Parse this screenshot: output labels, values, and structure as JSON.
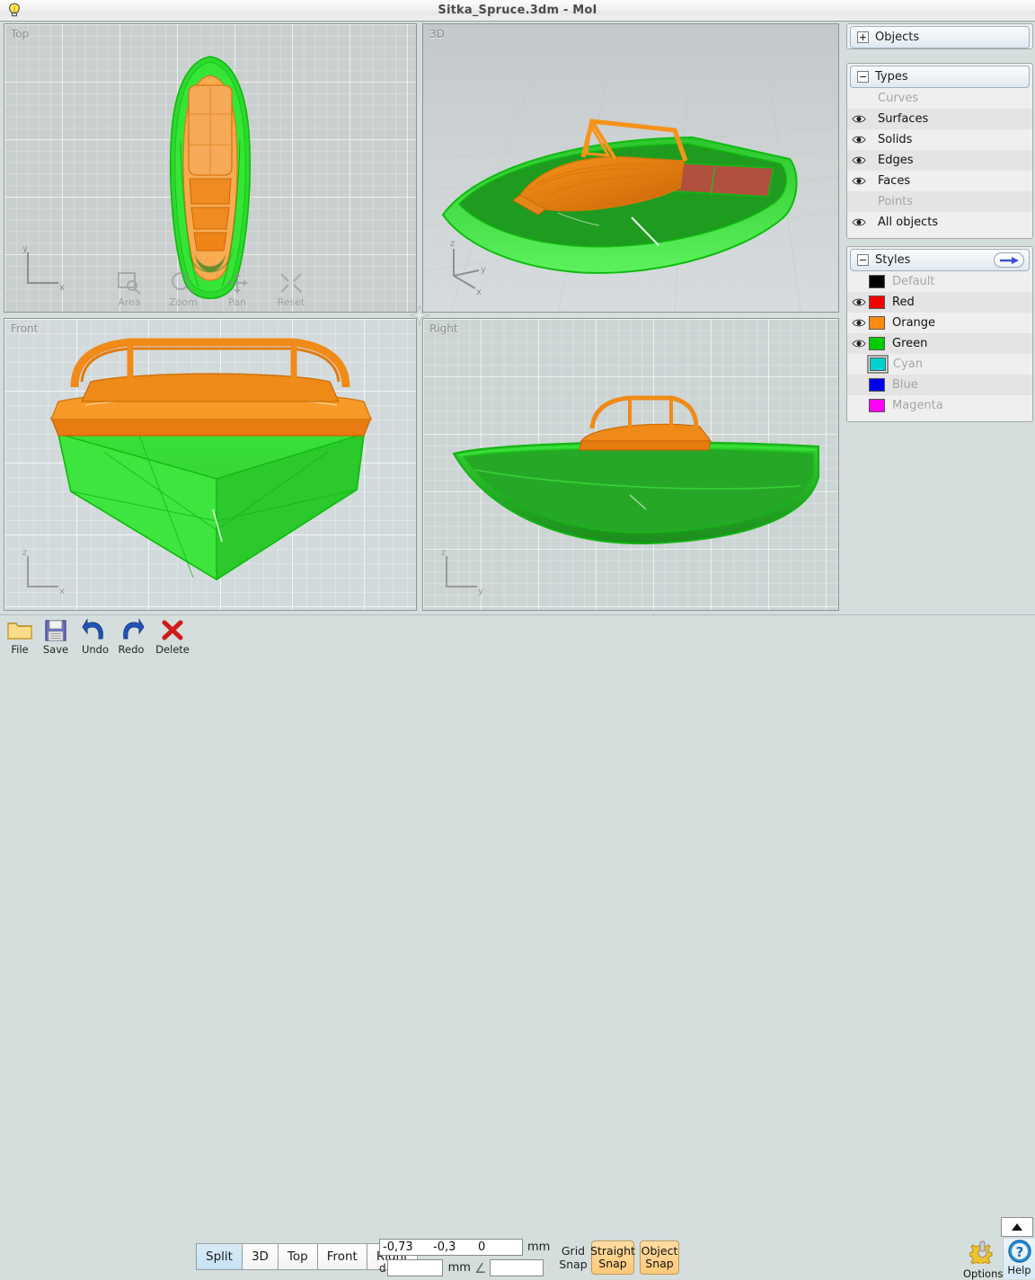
{
  "window": {
    "title": "Sitka_Spruce.3dm - MoI",
    "icon": "lightbulb-icon"
  },
  "viewports": [
    {
      "id": "top",
      "label": "Top",
      "axes": [
        "y",
        "x"
      ]
    },
    {
      "id": "3d",
      "label": "3D",
      "axes": [
        "z",
        "y",
        "x"
      ]
    },
    {
      "id": "front",
      "label": "Front",
      "axes": [
        "z",
        "x"
      ]
    },
    {
      "id": "right",
      "label": "Right",
      "axes": [
        "z",
        "y"
      ]
    }
  ],
  "nav_widgets": [
    {
      "name": "area",
      "label": "Area"
    },
    {
      "name": "zoom",
      "label": "Zoom"
    },
    {
      "name": "pan",
      "label": "Pan"
    },
    {
      "name": "reset",
      "label": "Reset"
    }
  ],
  "sidepanel": {
    "objects": {
      "label": "Objects",
      "expanded": false,
      "expander": "plus"
    },
    "types": {
      "label": "Types",
      "expanded": true,
      "expander": "minus",
      "items": [
        {
          "label": "Curves",
          "visible": false,
          "dim": true
        },
        {
          "label": "Surfaces",
          "visible": true,
          "dim": false
        },
        {
          "label": "Solids",
          "visible": true,
          "dim": false
        },
        {
          "label": "Edges",
          "visible": true,
          "dim": false
        },
        {
          "label": "Faces",
          "visible": true,
          "dim": false
        },
        {
          "label": "Points",
          "visible": false,
          "dim": true
        },
        {
          "label": "All objects",
          "visible": true,
          "dim": false
        }
      ]
    },
    "styles": {
      "label": "Styles",
      "expanded": true,
      "expander": "minus",
      "action_icon": "arrow-right-icon",
      "items": [
        {
          "label": "Default",
          "color": "#000000",
          "visible": false,
          "dim": true,
          "selected": false
        },
        {
          "label": "Red",
          "color": "#f50000",
          "visible": true,
          "dim": false,
          "selected": false
        },
        {
          "label": "Orange",
          "color": "#ff8a12",
          "visible": true,
          "dim": false,
          "selected": false
        },
        {
          "label": "Green",
          "color": "#00cc00",
          "visible": true,
          "dim": false,
          "selected": false
        },
        {
          "label": "Cyan",
          "color": "#00d2d2",
          "visible": false,
          "dim": true,
          "selected": true
        },
        {
          "label": "Blue",
          "color": "#0000ee",
          "visible": false,
          "dim": true,
          "selected": false
        },
        {
          "label": "Magenta",
          "color": "#ff00ff",
          "visible": false,
          "dim": true,
          "selected": false
        }
      ]
    }
  },
  "bottombar": {
    "tools": [
      {
        "name": "file",
        "label": "File",
        "icon": "folder-icon"
      },
      {
        "name": "save",
        "label": "Save",
        "icon": "floppy-icon"
      },
      {
        "name": "undo",
        "label": "Undo",
        "icon": "undo-arrow-icon"
      },
      {
        "name": "redo",
        "label": "Redo",
        "icon": "redo-arrow-icon"
      },
      {
        "name": "delete",
        "label": "Delete",
        "icon": "x-cross-icon"
      }
    ],
    "view_buttons": [
      {
        "label": "Split",
        "active": true
      },
      {
        "label": "3D",
        "active": false
      },
      {
        "label": "Top",
        "active": false
      },
      {
        "label": "Front",
        "active": false
      },
      {
        "label": "Right",
        "active": false
      }
    ],
    "coords": {
      "x": "-0,73",
      "y": "-0,3",
      "z": "0",
      "unit": "mm",
      "distance_label": "d",
      "distance_value": "",
      "distance_unit": "mm",
      "angle_symbol": "∠",
      "angle_value": ""
    },
    "snaps": [
      {
        "name": "grid-snap",
        "line1": "Grid",
        "line2": "Snap",
        "active": false
      },
      {
        "name": "straight-snap",
        "line1": "Straight",
        "line2": "Snap",
        "active": true
      },
      {
        "name": "object-snap",
        "line1": "Object",
        "line2": "Snap",
        "active": true
      }
    ],
    "options": {
      "label": "Options",
      "icon": "gear-icon"
    },
    "help": {
      "label": "Help",
      "icon": "question-circle-icon"
    },
    "collapse": {
      "icon": "up-triangle-icon"
    }
  },
  "colors": {
    "accent_green": "#33dd33",
    "accent_orange": "#f58220",
    "panel_bg": "#d4dedd",
    "snap_active": "#ffc97a"
  }
}
